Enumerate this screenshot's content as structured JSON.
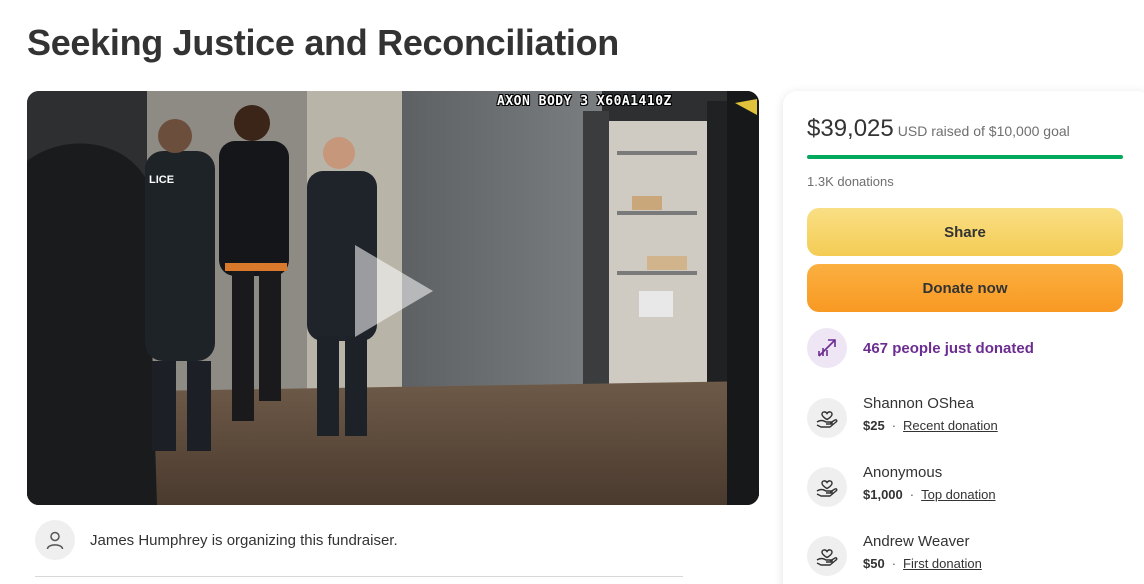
{
  "title": "Seeking Justice and Reconciliation",
  "video": {
    "overlay_text": "AXON BODY 3 X60A1410Z",
    "vest_label": "LICE"
  },
  "organizer": {
    "text": "James Humphrey is organizing this fundraiser."
  },
  "donation_card": {
    "amount_raised": "$39,025",
    "amount_sub": "USD raised of $10,000 goal",
    "progress_fraction": 1.0,
    "donation_count": "1.3K donations",
    "share_label": "Share",
    "donate_label": "Donate now",
    "trend_text": "467 people just donated",
    "donors": [
      {
        "name": "Shannon OShea",
        "amount": "$25",
        "tag": "Recent donation"
      },
      {
        "name": "Anonymous",
        "amount": "$1,000",
        "tag": "Top donation"
      },
      {
        "name": "Andrew Weaver",
        "amount": "$50",
        "tag": "First donation"
      }
    ]
  },
  "colors": {
    "progress": "#02a95c",
    "share_button": "#f4cc54",
    "donate_button": "#f89923",
    "trend_text": "#6c2d91",
    "trend_icon_bg": "#efe6f5"
  },
  "icons": {
    "organizer_avatar": "user-icon",
    "trend": "trending-up-icon",
    "donor": "donation-hand-heart-icon",
    "play": "play-icon"
  }
}
